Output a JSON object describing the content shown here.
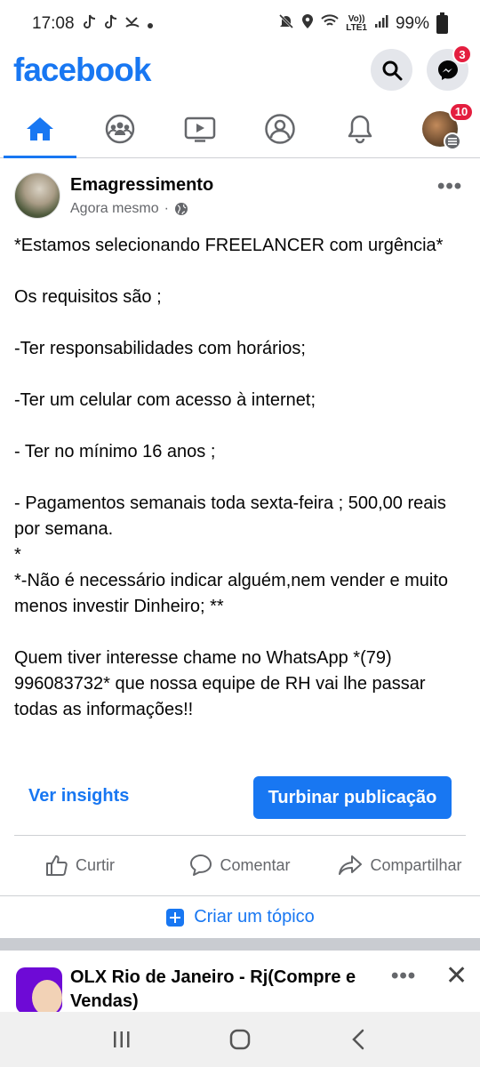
{
  "status_bar": {
    "time": "17:08",
    "network": "LTE1",
    "volte": "Vo))",
    "battery": "99%"
  },
  "header": {
    "logo": "facebook",
    "messenger_badge": "3"
  },
  "tabs": {
    "profile_badge": "10"
  },
  "post": {
    "author": "Emagressimento",
    "time": "Agora mesmo",
    "separator": "·",
    "more": "•••",
    "lines": [
      "*Estamos selecionando FREELANCER com urgência*",
      "",
      "Os requisitos são ;",
      "",
      "-Ter responsabilidades com horários;",
      "",
      "-Ter um celular com acesso à internet;",
      "",
      "- Ter no mínimo 16 anos ;",
      "",
      "- Pagamentos semanais toda sexta-feira ; 500,00 reais por semana.",
      "*",
      "*-Não é necessário indicar alguém,nem vender e muito menos investir Dinheiro; **",
      "",
      "Quem tiver interesse chame no WhatsApp *(79) 996083732* que nossa equipe de RH vai lhe passar todas as informações!!"
    ],
    "insights_label": "Ver insights",
    "boost_label": "Turbinar publicação",
    "like_label": "Curtir",
    "comment_label": "Comentar",
    "share_label": "Compartilhar",
    "topic_label": "Criar um tópico"
  },
  "next_post": {
    "title": "OLX Rio de Janeiro - Rj(Compre e Vendas)",
    "more": "•••",
    "close": "✕"
  },
  "colors": {
    "brand": "#1877f2",
    "badge": "#e41e3f",
    "secondary_text": "#65676b"
  }
}
